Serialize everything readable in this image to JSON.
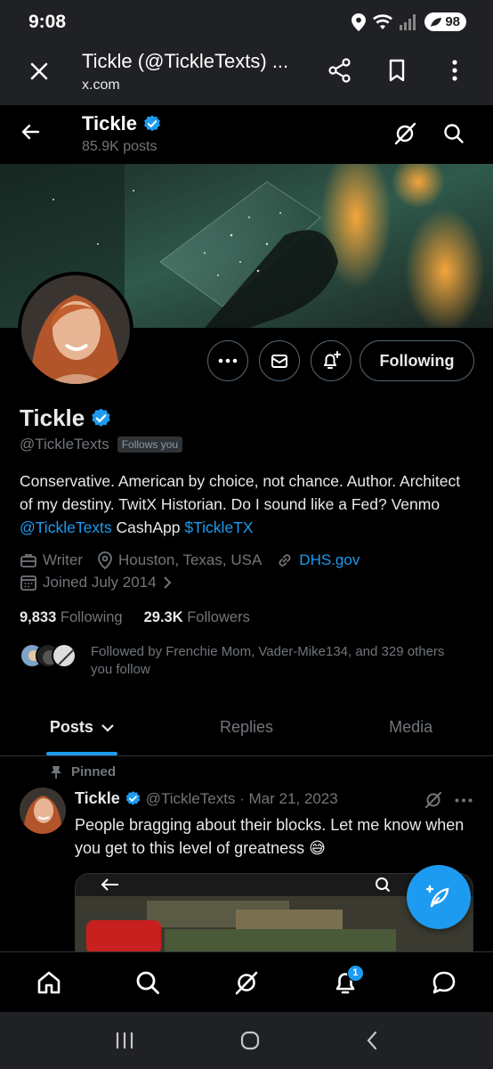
{
  "status_bar": {
    "time": "9:08",
    "battery": "98"
  },
  "browser": {
    "title": "Tickle (@TickleTexts) ...",
    "url": "x.com"
  },
  "header": {
    "name": "Tickle",
    "post_count": "85.9K posts"
  },
  "profile": {
    "name": "Tickle",
    "handle": "@TickleTexts",
    "follows_you": "Follows you",
    "following_button": "Following",
    "bio_text_1": "Conservative. American by choice, not chance. Author. Architect of my destiny. TwitX Historian. Do I sound like a Fed? Venmo ",
    "bio_link_1": "@TickleTexts",
    "bio_text_2": " CashApp ",
    "bio_link_2": "$TickleTX",
    "profession": "Writer",
    "location": "Houston, Texas, USA",
    "website": "DHS.gov",
    "joined": "Joined July 2014",
    "following_count": "9,833",
    "following_label": "Following",
    "followers_count": "29.3K",
    "followers_label": "Followers",
    "followed_by": "Followed by Frenchie Mom, Vader-Mike134, and 329 others you follow"
  },
  "tabs": [
    {
      "label": "Posts"
    },
    {
      "label": "Replies"
    },
    {
      "label": "Media"
    }
  ],
  "tweet": {
    "pinned_label": "Pinned",
    "name": "Tickle",
    "handle_date": "@TickleTexts · Mar 21, 2023",
    "text": "People bragging about their blocks. Let me know when you get to this level of greatness 😅"
  },
  "notifications_badge": "1",
  "colors": {
    "accent": "#1d9bf0",
    "background": "#000000",
    "muted": "#71767b"
  }
}
